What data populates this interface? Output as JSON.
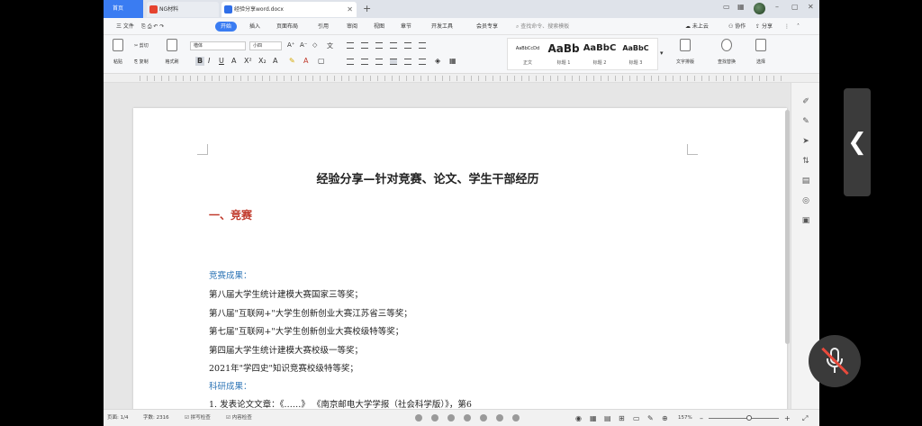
{
  "tabs": {
    "home": "首页",
    "pdf": "NG材料",
    "doc": "经验分享word.docx"
  },
  "menu": {
    "file": "三 文件",
    "items": [
      "开始",
      "插入",
      "页面布局",
      "引用",
      "审阅",
      "视图",
      "章节",
      "开发工具",
      "会员专享"
    ],
    "search_placeholder": "查找命令、搜索模板",
    "right": [
      "未上云",
      "协作",
      "分享"
    ]
  },
  "ribbon": {
    "paste": "粘贴",
    "cut": "剪切",
    "copy": "复制",
    "format_painter": "格式刷",
    "font_name": "楷体",
    "font_size": "小四",
    "styles": [
      {
        "sample": "AaBbCcDd",
        "name": "正文"
      },
      {
        "sample": "AaBb",
        "name": "标题 1"
      },
      {
        "sample": "AaBbC",
        "name": "标题 2"
      },
      {
        "sample": "AaBbC",
        "name": "标题 3"
      }
    ],
    "text_tools": "文字排版",
    "find_replace": "查找替换",
    "select": "选择"
  },
  "document": {
    "title": "经验分享—针对竞赛、论文、学生干部经历",
    "section1": "一、竞赛",
    "sub1": "竞赛成果：",
    "items": [
      "第八届大学生统计建模大赛国家三等奖；",
      "第八届\"互联网+\"大学生创新创业大赛江苏省三等奖；",
      "第七届\"互联网+\"大学生创新创业大赛校级特等奖；",
      "第四届大学生统计建模大赛校级一等奖；",
      "2021年\"学四史\"知识竞赛校级特等奖；"
    ],
    "sub2": "科研成果：",
    "partial": "1. 发表论文文章：《……》 《南京邮电大学学报（社会科学版）》，第6"
  },
  "status": {
    "page": "页面: 1/4",
    "words": "字数: 2316",
    "spell": "拼写检查",
    "content_check": "内容检查",
    "zoom": "157%"
  },
  "colors": {
    "accent": "#3a7cf2",
    "heading_red": "#c0392b",
    "subheading_blue": "#2e75b6"
  }
}
